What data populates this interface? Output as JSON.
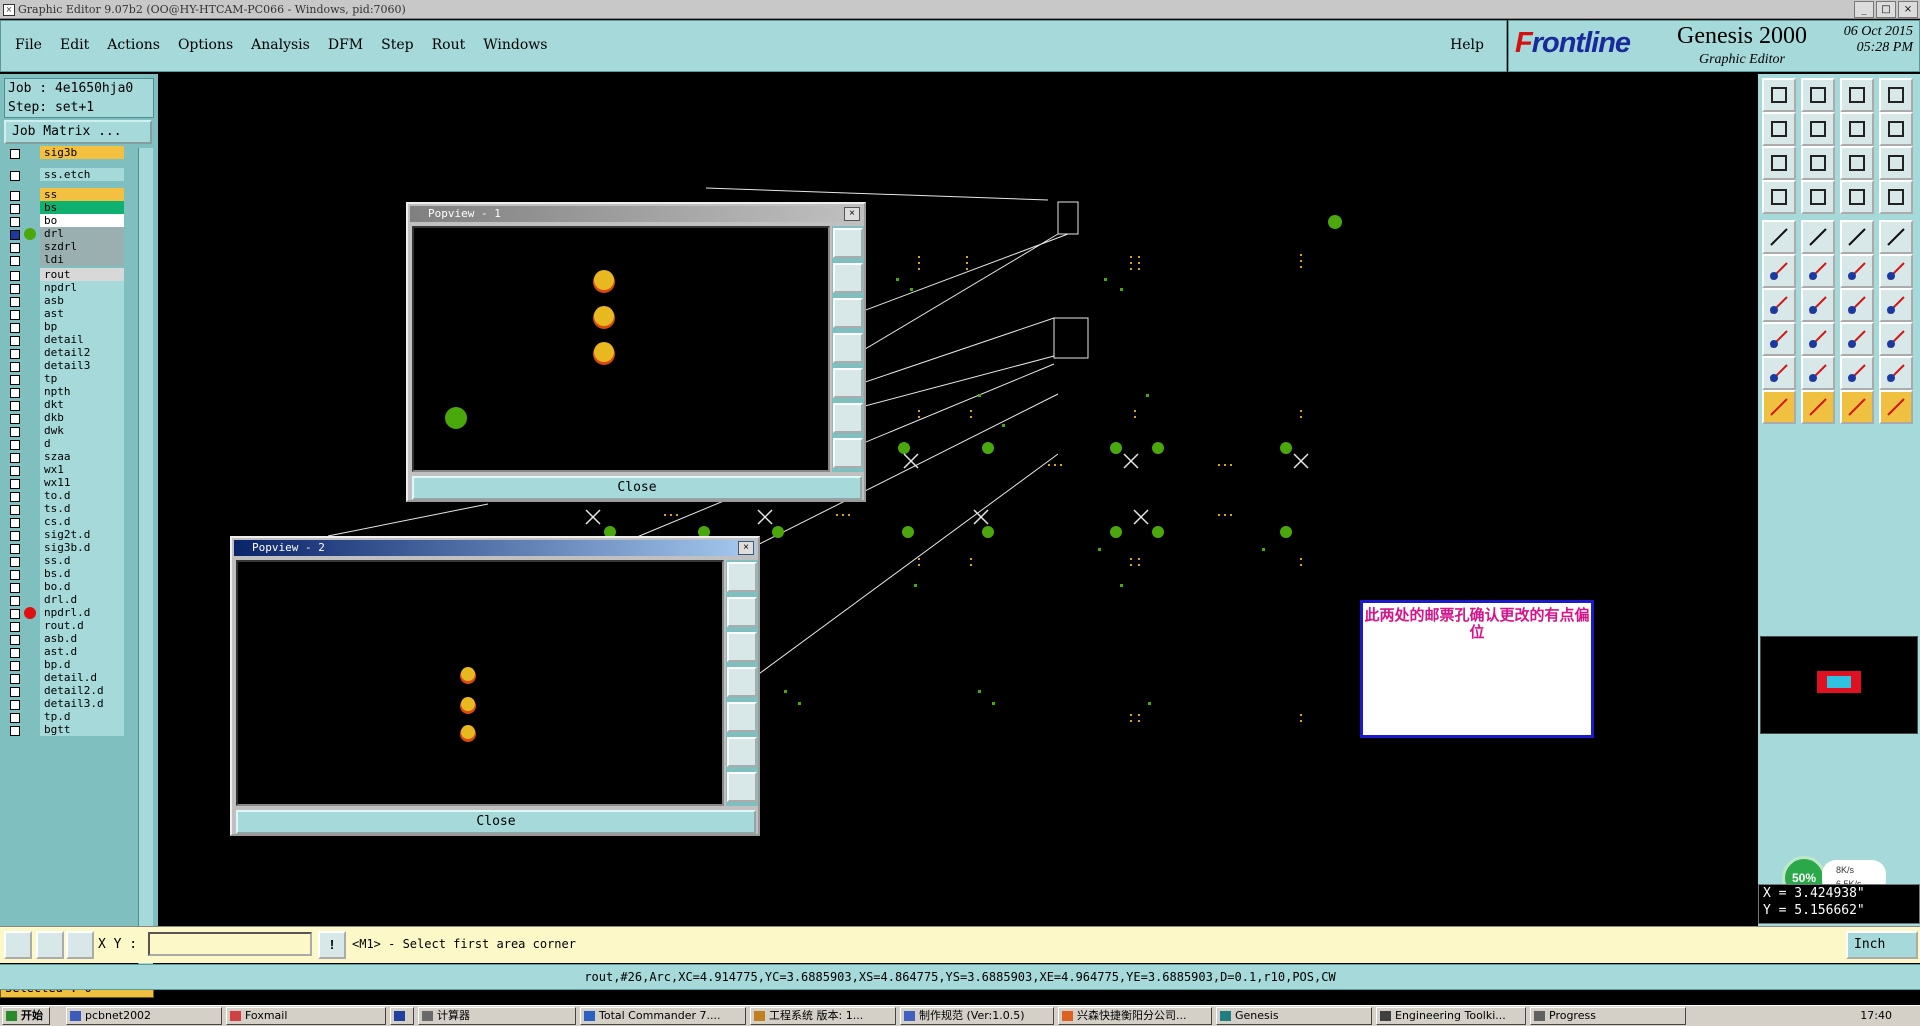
{
  "window": {
    "title": "Graphic Editor 9.07b2 (OO@HY-HTCAM-PC066 - Windows, pid:7060)",
    "buttons": [
      "_",
      "□",
      "×"
    ]
  },
  "menu": {
    "items": [
      "File",
      "Edit",
      "Actions",
      "Options",
      "Analysis",
      "DFM",
      "Step",
      "Rout",
      "Windows"
    ],
    "help": "Help"
  },
  "brand": {
    "logo_f": "F",
    "logo_rest": "rontline",
    "product": "Genesis 2000",
    "subtitle": "Graphic Editor",
    "date": "06 Oct 2015",
    "time": "05:28 PM"
  },
  "job": {
    "job_line": "Job : 4e1650hja0",
    "step_line": "Step: set+1",
    "job_matrix": "Job Matrix ..."
  },
  "layers": [
    {
      "name": "sig3b",
      "color": "#f4c040"
    },
    {
      "name": "ss.etch",
      "color": "#a6d9d9"
    },
    {
      "name": "ss",
      "color": "#f4c040"
    },
    {
      "name": "bs",
      "color": "#10b070"
    },
    {
      "name": "bo",
      "color": "#ffffff"
    },
    {
      "name": "drl",
      "color": "#9ab0b0",
      "active": true
    },
    {
      "name": "szdrl",
      "color": "#9ab0b0"
    },
    {
      "name": "ldi",
      "color": "#9ab0b0"
    },
    {
      "name": "rout",
      "color": "#d8d8d8"
    },
    {
      "name": "npdrl",
      "color": "#a6d9d9"
    },
    {
      "name": "asb",
      "color": "#a6d9d9"
    },
    {
      "name": "ast",
      "color": "#a6d9d9"
    },
    {
      "name": "bp",
      "color": "#a6d9d9"
    },
    {
      "name": "detail",
      "color": "#a6d9d9"
    },
    {
      "name": "detail2",
      "color": "#a6d9d9"
    },
    {
      "name": "detail3",
      "color": "#a6d9d9"
    },
    {
      "name": "tp",
      "color": "#a6d9d9"
    },
    {
      "name": "npth",
      "color": "#a6d9d9"
    },
    {
      "name": "dkt",
      "color": "#a6d9d9"
    },
    {
      "name": "dkb",
      "color": "#a6d9d9"
    },
    {
      "name": "dwk",
      "color": "#a6d9d9"
    },
    {
      "name": "d",
      "color": "#a6d9d9"
    },
    {
      "name": "szaa",
      "color": "#a6d9d9"
    },
    {
      "name": "wx1",
      "color": "#a6d9d9"
    },
    {
      "name": "wx11",
      "color": "#a6d9d9"
    },
    {
      "name": "to.d",
      "color": "#a6d9d9"
    },
    {
      "name": "ts.d",
      "color": "#a6d9d9"
    },
    {
      "name": "cs.d",
      "color": "#a6d9d9"
    },
    {
      "name": "sig2t.d",
      "color": "#a6d9d9"
    },
    {
      "name": "sig3b.d",
      "color": "#a6d9d9"
    },
    {
      "name": "ss.d",
      "color": "#a6d9d9"
    },
    {
      "name": "bs.d",
      "color": "#a6d9d9"
    },
    {
      "name": "bo.d",
      "color": "#a6d9d9"
    },
    {
      "name": "drl.d",
      "color": "#a6d9d9"
    },
    {
      "name": "npdrl.d",
      "color": "#a6d9d9",
      "marker": "red"
    },
    {
      "name": "rout.d",
      "color": "#a6d9d9"
    },
    {
      "name": "asb.d",
      "color": "#a6d9d9"
    },
    {
      "name": "ast.d",
      "color": "#a6d9d9"
    },
    {
      "name": "bp.d",
      "color": "#a6d9d9"
    },
    {
      "name": "detail.d",
      "color": "#a6d9d9"
    },
    {
      "name": "detail2.d",
      "color": "#a6d9d9"
    },
    {
      "name": "detail3.d",
      "color": "#a6d9d9"
    },
    {
      "name": "tp.d",
      "color": "#a6d9d9"
    },
    {
      "name": "bgtt",
      "color": "#a6d9d9"
    }
  ],
  "selected": "Selected : 0",
  "popview1": {
    "title": "Popview - 1",
    "close": "Close"
  },
  "popview2": {
    "title": "Popview - 2",
    "close": "Close"
  },
  "note": "此两处的邮票孔确认更改的有点偏位",
  "status": {
    "xy_label": "X Y :",
    "xy_value": "",
    "prompt": "<M1> - Select first area corner",
    "units": "Inch"
  },
  "infobar": "rout,#26,Arc,XC=4.914775,YC=3.6885903,XS=4.864775,YS=3.6885903,XE=4.964775,YE=3.6885903,D=0.1,r10,POS,CW",
  "coords": {
    "x": "X = 3.424938\"",
    "y": "Y = 5.156662\""
  },
  "network": {
    "percent": "50%",
    "up": "8K/s",
    "down": "6.5K/s"
  },
  "taskbar": {
    "start": "开始",
    "items": [
      "pcbnet2002",
      "Foxmail",
      "",
      "计算器",
      "Total Commander 7....",
      "工程系统  版本: 1...",
      "制作规范 (Ver:1.0.5)",
      "兴森快捷衡阳分公司...",
      "Genesis",
      "Engineering Toolki...",
      "Progress"
    ],
    "clock": "17:40"
  }
}
